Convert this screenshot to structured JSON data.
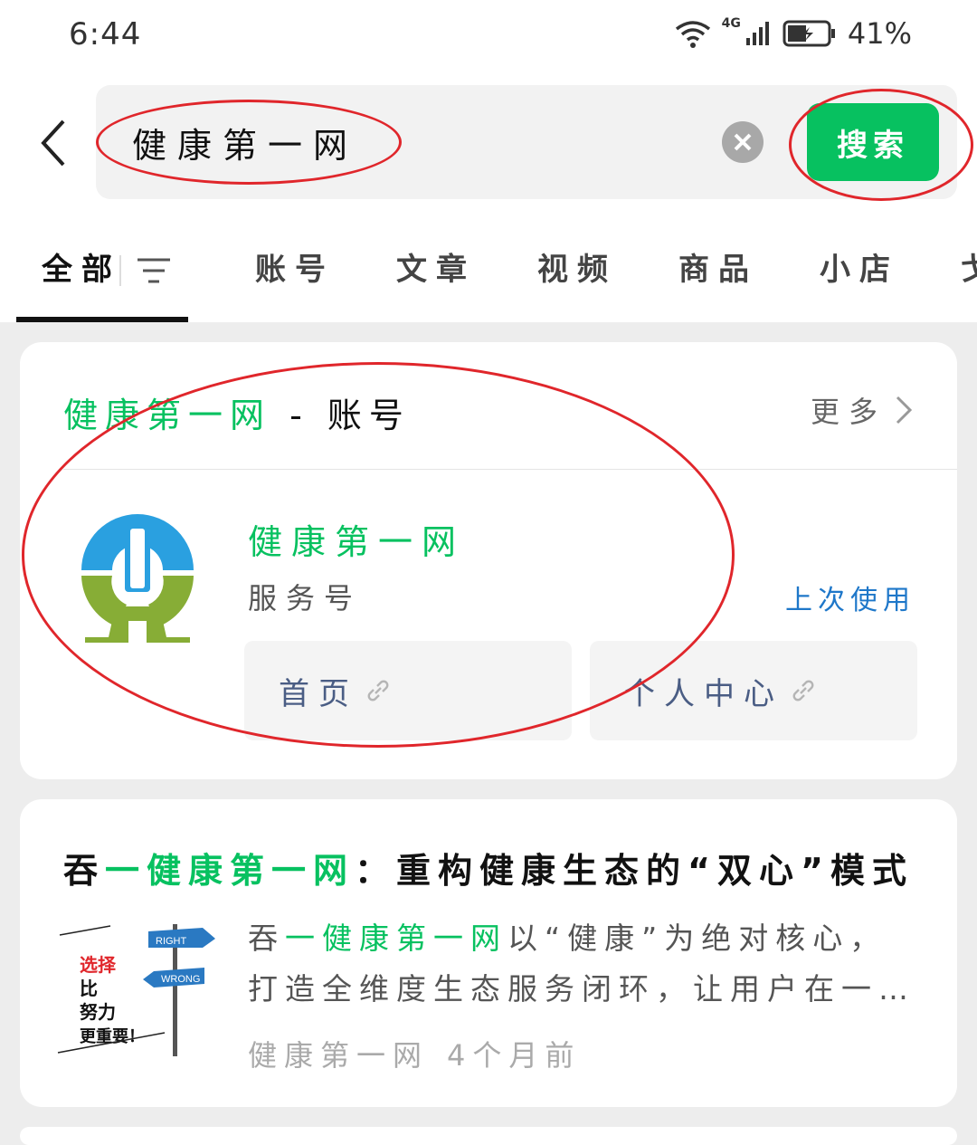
{
  "status_bar": {
    "time": "6:44",
    "network": "4G",
    "battery": "41%"
  },
  "search": {
    "query": "健康第一网",
    "button_label": "搜索"
  },
  "tabs": [
    {
      "label": "全部"
    },
    {
      "label": "账号"
    },
    {
      "label": "文章"
    },
    {
      "label": "视频"
    },
    {
      "label": "商品"
    },
    {
      "label": "小店"
    },
    {
      "label": "戈"
    }
  ],
  "account_section": {
    "title_keyword": "健康第一网",
    "title_suffix": "- 账号",
    "more_label": "更多",
    "account_name": "健康第一网",
    "account_type": "服务号",
    "last_used": "上次使用",
    "links": [
      {
        "label": "首页"
      },
      {
        "label": "个人中心"
      }
    ]
  },
  "article": {
    "title_prefix": "吞",
    "title_keyword": "一健康第一网",
    "title_suffix": "：重构健康生态的“双心”模式",
    "desc_prefix": "吞",
    "desc_keyword": "一健康第一网",
    "desc_suffix": "以“健康”为绝对核心，打造全维度生态服务闭环，让用户在一…",
    "source": "健康第一网",
    "time": "4个月前",
    "thumb_text": {
      "line1": "选择",
      "line2": "比",
      "line3": "努力",
      "line4": "更重要！",
      "sign_right": "RIGHT",
      "sign_wrong": "WRONG"
    }
  },
  "colors": {
    "accent": "#07c160",
    "link_blue": "#1e77c9",
    "annotation_red": "#e0262b"
  }
}
